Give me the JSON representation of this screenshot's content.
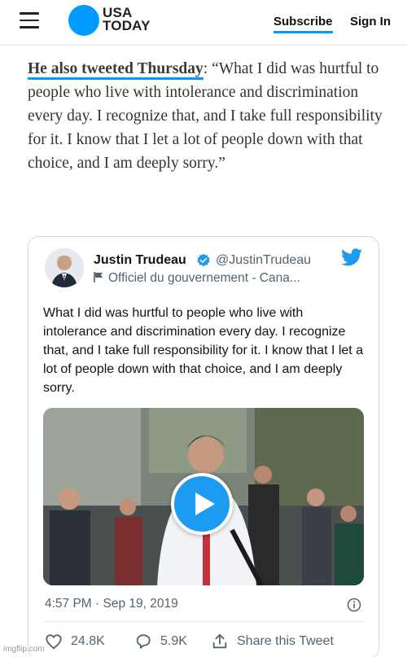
{
  "header": {
    "logo_line1": "USA",
    "logo_line2": "TODAY",
    "subscribe_label": "Subscribe",
    "signin_label": "Sign In",
    "accent_color": "#009bff"
  },
  "article": {
    "link_text": "He also tweeted Thursday",
    "quote_text": ": “What I did was hurtful to people who live with intolerance and discrimination every day. I recognize that, and I take full responsibility for it. I know that I let a lot of people down with that choice, and I am deeply sorry.”"
  },
  "tweet": {
    "author_name": "Justin Trudeau",
    "handle": "@JustinTrudeau",
    "account_label": "Officiel du gouvernement - Cana...",
    "text": "What I did was hurtful to people who live with intolerance and discrimination every day. I recognize that, and I take full responsibility for it. I know that I let a lot of people down with that choice, and I am deeply sorry.",
    "timestamp": "4:57 PM · Sep 19, 2019",
    "likes": "24.8K",
    "replies": "5.9K",
    "share_label": "Share this Tweet",
    "icons": [
      "verified-badge-icon",
      "twitter-bird-icon",
      "government-flag-icon",
      "play-icon",
      "info-icon",
      "heart-icon",
      "reply-icon",
      "share-icon"
    ],
    "twitter_blue": "#1d9bf0"
  },
  "watermark": "imgflip.com"
}
